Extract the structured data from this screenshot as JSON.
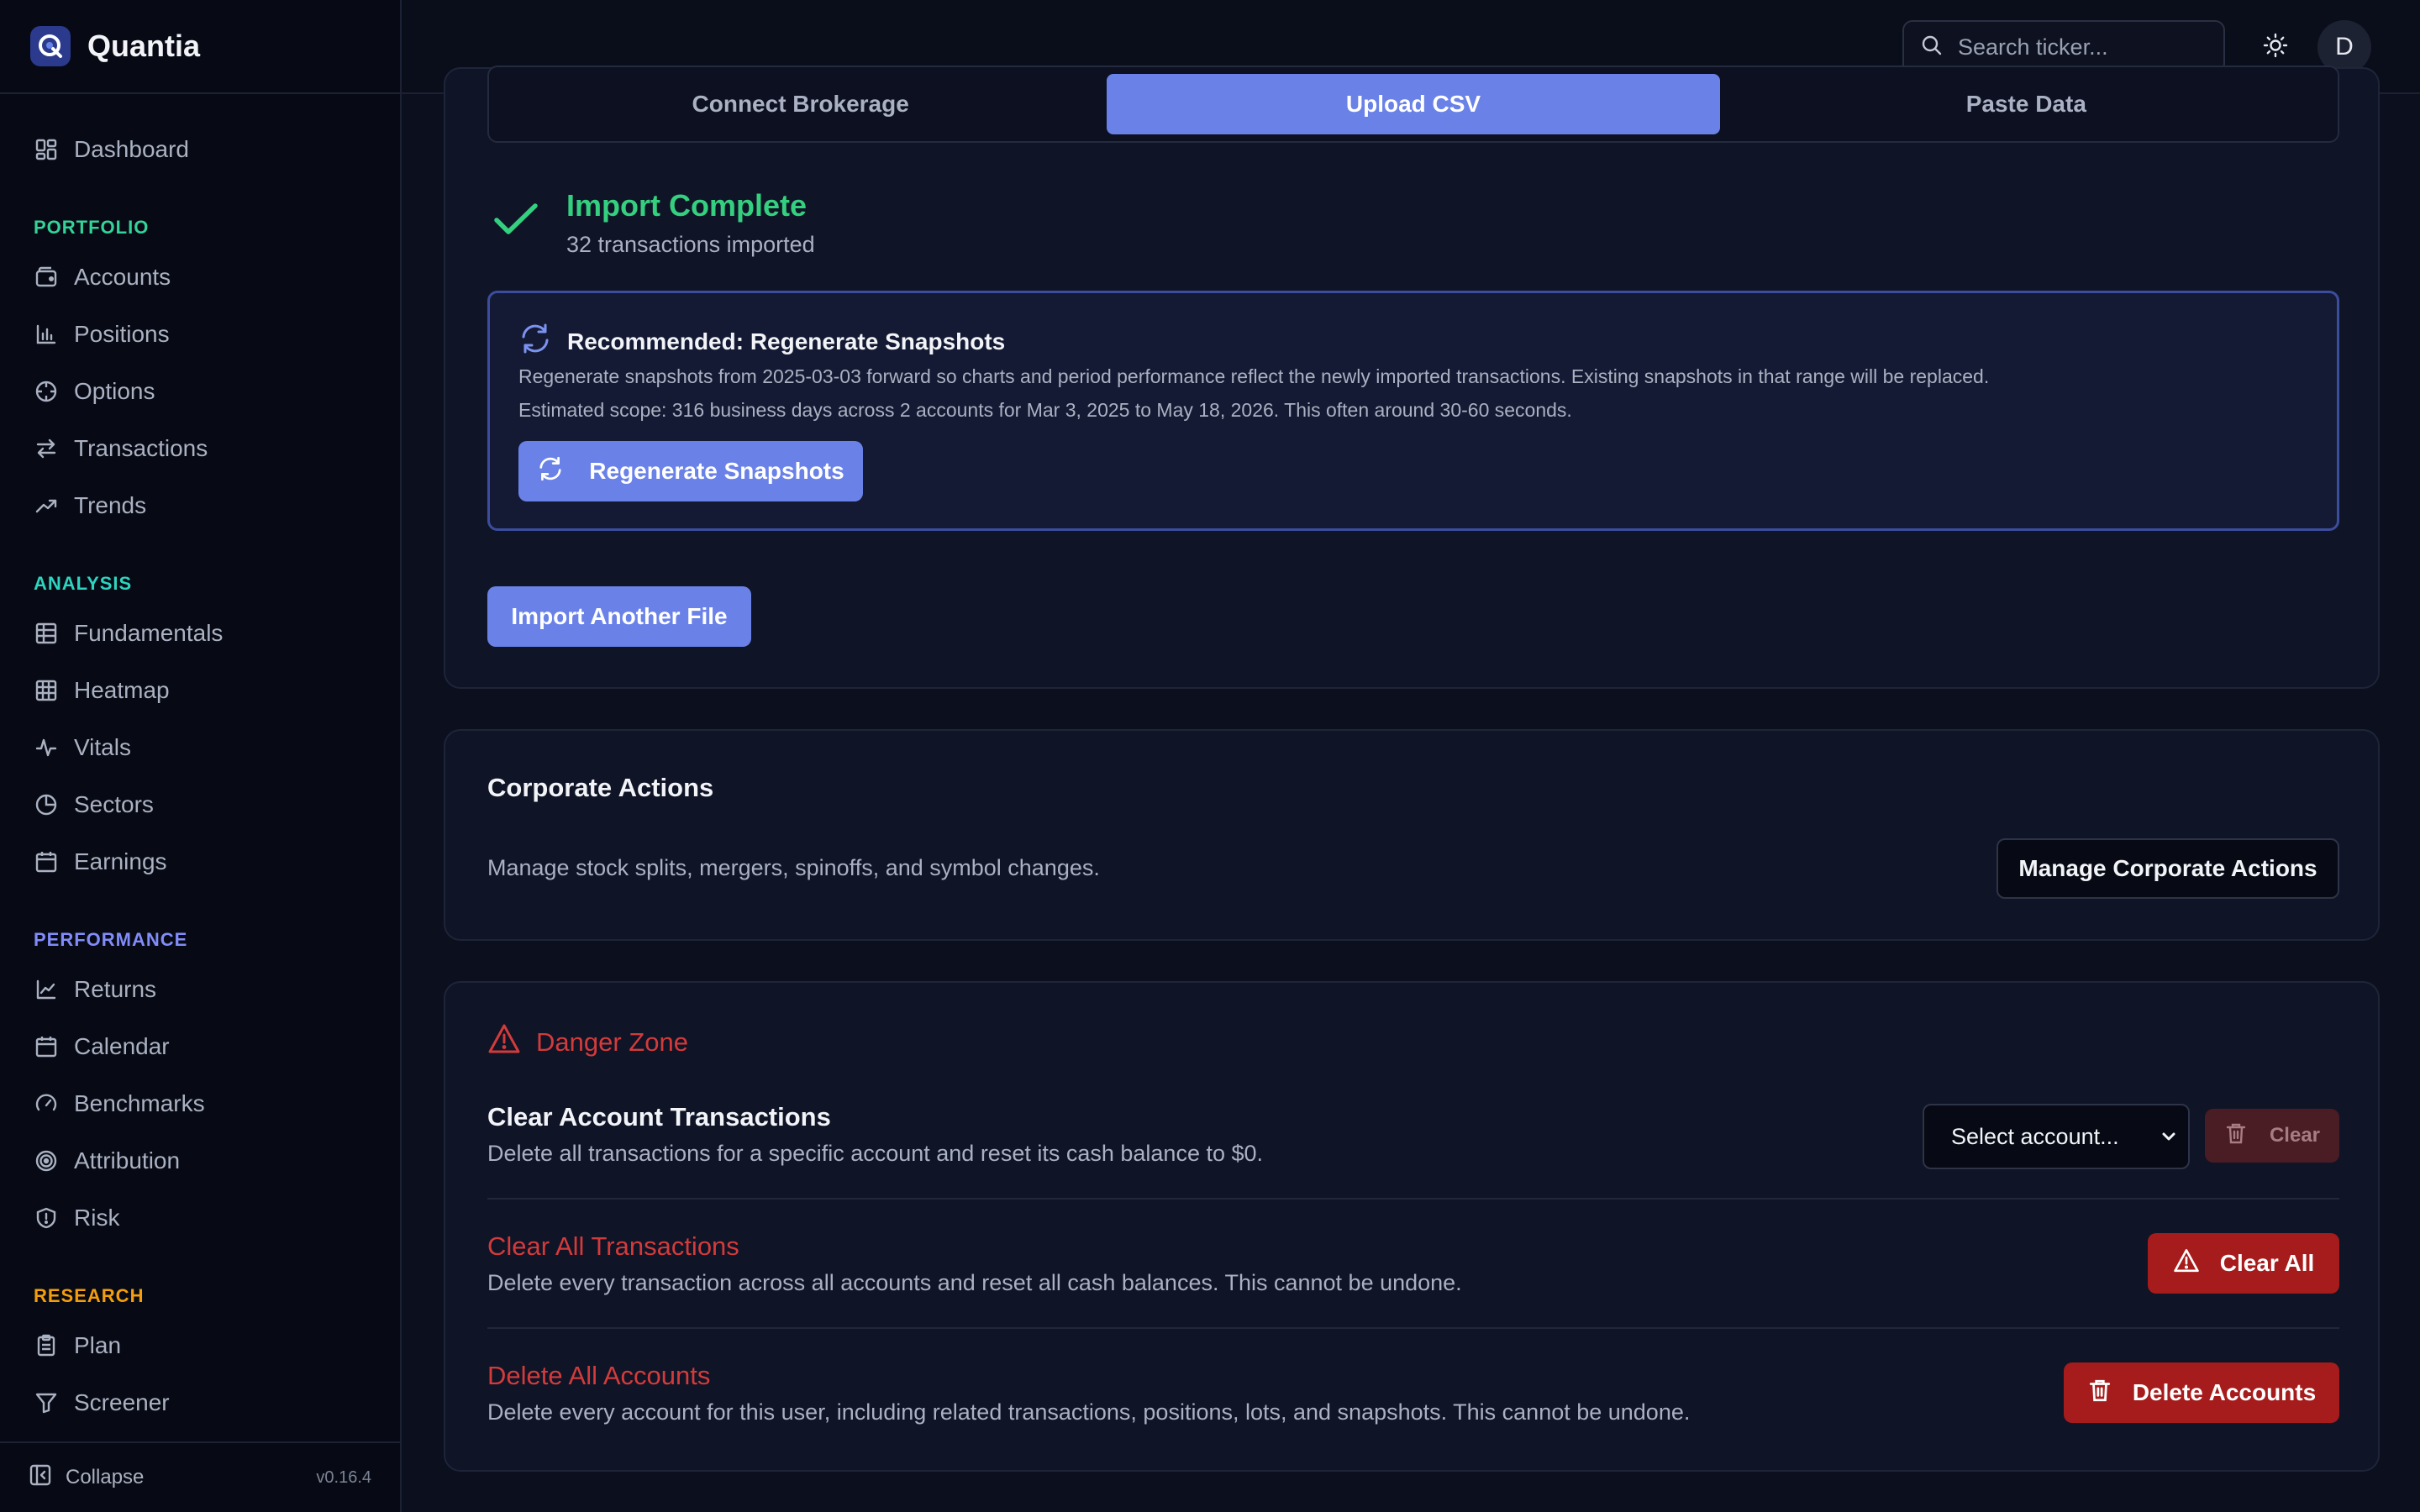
{
  "app": {
    "name": "Quantia",
    "version": "v0.16.4"
  },
  "header": {
    "search_placeholder": "Search ticker...",
    "avatar_initial": "D",
    "theme_icon": "sun-icon"
  },
  "sidebar": {
    "top": [
      {
        "label": "Dashboard",
        "icon": "dashboard-icon"
      }
    ],
    "sections": [
      {
        "label": "PORTFOLIO",
        "color": "#34d399",
        "items": [
          {
            "label": "Accounts",
            "icon": "wallet-icon"
          },
          {
            "label": "Positions",
            "icon": "bar-chart-icon"
          },
          {
            "label": "Options",
            "icon": "crosshair-icon"
          },
          {
            "label": "Transactions",
            "icon": "transfer-icon"
          },
          {
            "label": "Trends",
            "icon": "trending-up-icon"
          }
        ]
      },
      {
        "label": "ANALYSIS",
        "color": "#2dd4bf",
        "items": [
          {
            "label": "Fundamentals",
            "icon": "table-icon"
          },
          {
            "label": "Heatmap",
            "icon": "grid-icon"
          },
          {
            "label": "Vitals",
            "icon": "activity-icon"
          },
          {
            "label": "Sectors",
            "icon": "pie-chart-icon"
          },
          {
            "label": "Earnings",
            "icon": "calendar-icon"
          }
        ]
      },
      {
        "label": "PERFORMANCE",
        "color": "#818cf8",
        "items": [
          {
            "label": "Returns",
            "icon": "line-chart-icon"
          },
          {
            "label": "Calendar",
            "icon": "calendar-icon"
          },
          {
            "label": "Benchmarks",
            "icon": "gauge-icon"
          },
          {
            "label": "Attribution",
            "icon": "target-icon"
          },
          {
            "label": "Risk",
            "icon": "shield-icon"
          }
        ]
      },
      {
        "label": "RESEARCH",
        "color": "#f59e0b",
        "items": [
          {
            "label": "Plan",
            "icon": "clipboard-icon"
          },
          {
            "label": "Screener",
            "icon": "filter-icon"
          }
        ]
      }
    ],
    "collapse_label": "Collapse"
  },
  "import": {
    "tabs": [
      {
        "label": "Connect Brokerage",
        "active": false
      },
      {
        "label": "Upload CSV",
        "active": true
      },
      {
        "label": "Paste Data",
        "active": false
      }
    ],
    "status_title": "Import Complete",
    "status_sub": "32 transactions imported",
    "recommend": {
      "title": "Recommended: Regenerate Snapshots",
      "line1": "Regenerate snapshots from 2025-03-03 forward so charts and period performance reflect the newly imported transactions. Existing snapshots in that range will be replaced.",
      "line2": "Estimated scope: 316 business days across 2 accounts for Mar 3, 2025 to May 18, 2026. This often around 30-60 seconds.",
      "button": "Regenerate Snapshots"
    },
    "another_button": "Import Another File"
  },
  "corporate": {
    "title": "Corporate Actions",
    "desc": "Manage stock splits, mergers, spinoffs, and symbol changes.",
    "button": "Manage Corporate Actions"
  },
  "danger": {
    "title": "Danger Zone",
    "clear_account": {
      "title": "Clear Account Transactions",
      "desc": "Delete all transactions for a specific account and reset its cash balance to $0.",
      "select_value": "Select account...",
      "button": "Clear"
    },
    "clear_all": {
      "title": "Clear All Transactions",
      "desc": "Delete every transaction across all accounts and reset all cash balances. This cannot be undone.",
      "button": "Clear All"
    },
    "delete_accounts": {
      "title": "Delete All Accounts",
      "desc": "Delete every account for this user, including related transactions, positions, lots, and snapshots. This cannot be undone.",
      "button": "Delete Accounts"
    }
  },
  "colors": {
    "accent": "#6a82e8",
    "success": "#35d07f",
    "danger": "#d33b3b",
    "danger_button": "#a61b1b"
  }
}
